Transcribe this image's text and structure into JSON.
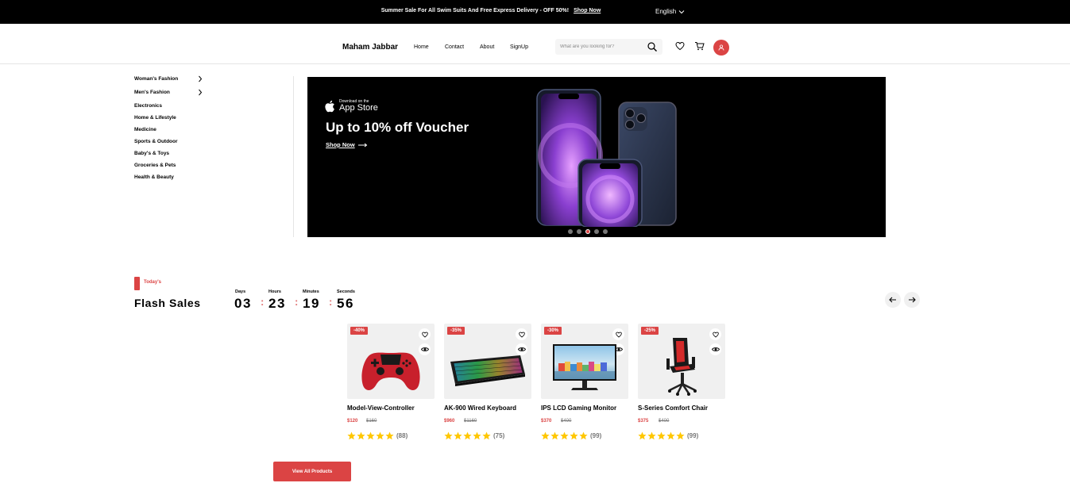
{
  "topbar": {
    "promo_text": "Summer Sale For All Swim Suits And Free Express Delivery - OFF 50%!",
    "promo_link": "Shop Now",
    "language": "English"
  },
  "header": {
    "logo": "Maham Jabbar",
    "nav": [
      "Home",
      "Contact",
      "About",
      "SignUp"
    ],
    "search_placeholder": "What are you looking for?"
  },
  "sidebar": {
    "categories": [
      {
        "label": "Woman's Fashion",
        "has_submenu": true
      },
      {
        "label": "Men's Fashion",
        "has_submenu": true
      },
      {
        "label": "Electronics",
        "has_submenu": false
      },
      {
        "label": "Home & Lifestyle",
        "has_submenu": false
      },
      {
        "label": "Medicine",
        "has_submenu": false
      },
      {
        "label": "Sports & Outdoor",
        "has_submenu": false
      },
      {
        "label": "Baby's & Toys",
        "has_submenu": false
      },
      {
        "label": "Groceries & Pets",
        "has_submenu": false
      },
      {
        "label": "Health & Beauty",
        "has_submenu": false
      }
    ]
  },
  "banner": {
    "store_small": "Download on the",
    "store_big": "App Store",
    "headline": "Up to 10% off Voucher",
    "cta": "Shop Now",
    "active_dot": 3,
    "dot_count": 5
  },
  "flash": {
    "tag": "Today's",
    "title": "Flash Sales",
    "countdown": [
      {
        "label": "Days",
        "value": "03"
      },
      {
        "label": "Hours",
        "value": "23"
      },
      {
        "label": "Minutes",
        "value": "19"
      },
      {
        "label": "Seconds",
        "value": "56"
      }
    ]
  },
  "products": [
    {
      "name": "Model-View-Controller",
      "discount": "-40%",
      "price": "$120",
      "old_price": "$160",
      "rating": 5,
      "reviews": "(88)",
      "icon": "gamepad-image"
    },
    {
      "name": "AK-900 Wired Keyboard",
      "discount": "-35%",
      "price": "$960",
      "old_price": "$1160",
      "rating": 5,
      "reviews": "(75)",
      "icon": "keyboard-image"
    },
    {
      "name": "IPS LCD Gaming Monitor",
      "discount": "-30%",
      "price": "$370",
      "old_price": "$400",
      "rating": 5,
      "reviews": "(99)",
      "icon": "monitor-image"
    },
    {
      "name": "S-Series Comfort Chair",
      "discount": "-25%",
      "price": "$375",
      "old_price": "$400",
      "rating": 5,
      "reviews": "(99)",
      "icon": "chair-image"
    }
  ],
  "view_all": "View All Products",
  "colors": {
    "accent": "#db4444",
    "star": "#ffc700",
    "topbar": "#000000"
  }
}
